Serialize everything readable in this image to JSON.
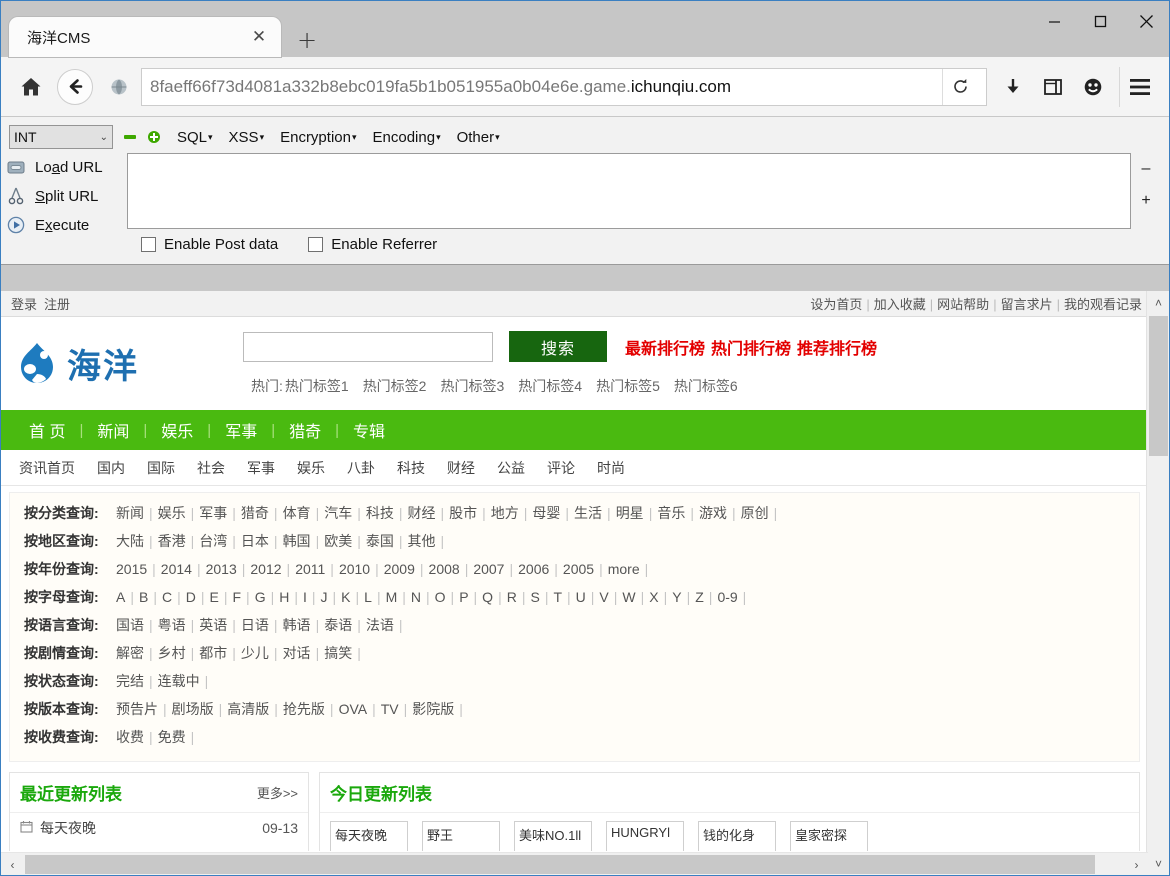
{
  "browser": {
    "tab": {
      "title": "海洋CMS",
      "close_label": "✕",
      "new_tab_label": "+"
    },
    "window_controls": {
      "minimize": "minimize-icon",
      "maximize": "maximize-icon",
      "close": "close-icon"
    },
    "url": {
      "prefix": "8faeff66f73d4081a332b8ebc019fa5b1b051955a0b04e6e.game.",
      "domain": "ichunqiu.com"
    },
    "icons": {
      "home": "home-icon",
      "back": "back-arrow-icon",
      "site": "globe-icon",
      "reload": "reload-icon",
      "download": "download-icon",
      "library": "library-icon",
      "account": "smiley-icon",
      "menu": "hamburger-menu-icon"
    }
  },
  "hackbar": {
    "type_select": {
      "value": "INT",
      "chevron": "⌄"
    },
    "menus": [
      {
        "label": "SQL",
        "caret": "▾"
      },
      {
        "label": "XSS",
        "caret": "▾"
      },
      {
        "label": "Encryption",
        "caret": "▾"
      },
      {
        "label": "Encoding",
        "caret": "▾"
      },
      {
        "label": "Other",
        "caret": "▾"
      }
    ],
    "actions": [
      {
        "icon": "load-url-icon",
        "pre": "Lo",
        "accel": "a",
        "post": "d URL"
      },
      {
        "icon": "split-url-icon",
        "pre": "",
        "accel": "S",
        "post": "plit URL"
      },
      {
        "icon": "execute-icon",
        "pre": "E",
        "accel": "x",
        "post": "ecute"
      }
    ],
    "textarea_value": "",
    "checkboxes": [
      {
        "label": "Enable Post data",
        "checked": false
      },
      {
        "label": "Enable Referrer",
        "checked": false
      }
    ],
    "side_buttons": [
      "–",
      "+"
    ]
  },
  "page": {
    "topbar": {
      "left": [
        "登录",
        "注册"
      ],
      "right": [
        "设为首页",
        "加入收藏",
        "网站帮助",
        "留言求片",
        "我的观看记录"
      ]
    },
    "logo": {
      "text": "海洋",
      "icon": "water-drop-logo-icon"
    },
    "search": {
      "value": "",
      "button_label": "搜索"
    },
    "rank_links": [
      "最新排行榜",
      "热门排行榜",
      "推荐排行榜"
    ],
    "hot": {
      "label": "热门:",
      "tags": [
        "热门标签1",
        "热门标签2",
        "热门标签3",
        "热门标签4",
        "热门标签5",
        "热门标签6"
      ]
    },
    "mainnav": [
      "首 页",
      "新闻",
      "娱乐",
      "军事",
      "猎奇",
      "专辑"
    ],
    "subnav": [
      "资讯首页",
      "国内",
      "国际",
      "社会",
      "军事",
      "娱乐",
      "八卦",
      "科技",
      "财经",
      "公益",
      "评论",
      "时尚"
    ],
    "filters": [
      {
        "label": "按分类查询:",
        "values": [
          "新闻",
          "娱乐",
          "军事",
          "猎奇",
          "体育",
          "汽车",
          "科技",
          "财经",
          "股市",
          "地方",
          "母婴",
          "生活",
          "明星",
          "音乐",
          "游戏",
          "原创"
        ]
      },
      {
        "label": "按地区查询:",
        "values": [
          "大陆",
          "香港",
          "台湾",
          "日本",
          "韩国",
          "欧美",
          "泰国",
          "其他"
        ]
      },
      {
        "label": "按年份查询:",
        "values": [
          "2015",
          "2014",
          "2013",
          "2012",
          "2011",
          "2010",
          "2009",
          "2008",
          "2007",
          "2006",
          "2005",
          "more"
        ]
      },
      {
        "label": "按字母查询:",
        "values": [
          "A",
          "B",
          "C",
          "D",
          "E",
          "F",
          "G",
          "H",
          "I",
          "J",
          "K",
          "L",
          "M",
          "N",
          "O",
          "P",
          "Q",
          "R",
          "S",
          "T",
          "U",
          "V",
          "W",
          "X",
          "Y",
          "Z",
          "0-9"
        ]
      },
      {
        "label": "按语言查询:",
        "values": [
          "国语",
          "粤语",
          "英语",
          "日语",
          "韩语",
          "泰语",
          "法语"
        ]
      },
      {
        "label": "按剧情查询:",
        "values": [
          "解密",
          "乡村",
          "都市",
          "少儿",
          "对话",
          "搞笑"
        ]
      },
      {
        "label": "按状态查询:",
        "values": [
          "完结",
          "连载中"
        ]
      },
      {
        "label": "按版本查询:",
        "values": [
          "预告片",
          "剧场版",
          "高清版",
          "抢先版",
          "OVA",
          "TV",
          "影院版"
        ]
      },
      {
        "label": "按收费查询:",
        "values": [
          "收费",
          "免费"
        ]
      }
    ],
    "recent_panel": {
      "title": "最近更新列表",
      "more": "更多>>",
      "rows": [
        {
          "icon": "calendar-icon",
          "name": "每天夜晚",
          "date": "09-13"
        }
      ]
    },
    "today_panel": {
      "title": "今日更新列表",
      "thumbs": [
        "每天夜晚",
        "野王",
        "美味NO.1ll",
        "HUNGRYl",
        "钱的化身",
        "皇家密探"
      ]
    }
  },
  "scrollbars": {
    "vertical": {
      "up": "˄",
      "down": "˅"
    },
    "horizontal": {
      "left": "‹",
      "right": "›"
    }
  }
}
